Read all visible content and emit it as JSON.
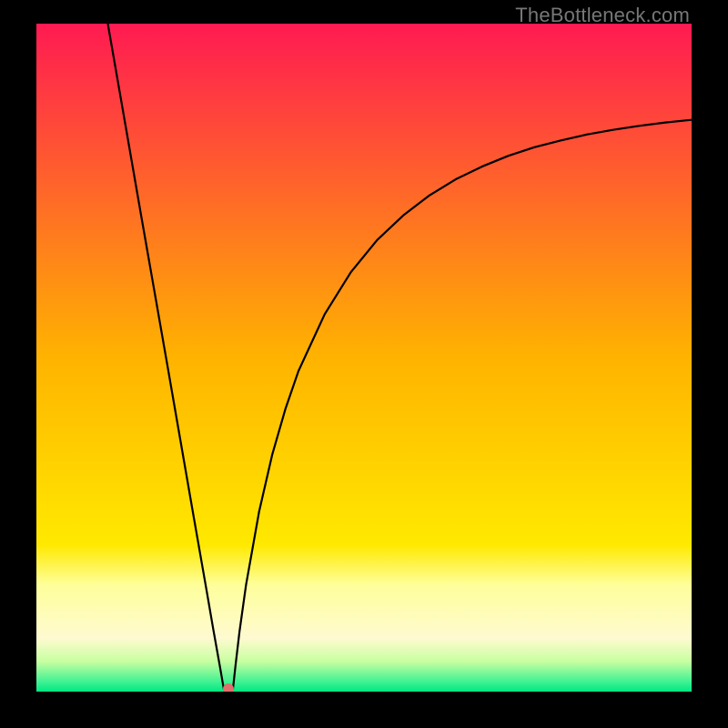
{
  "watermark": "TheBottleneck.com",
  "chart_data": {
    "type": "line",
    "title": "",
    "xlabel": "",
    "ylabel": "",
    "xlim": [
      0,
      100
    ],
    "ylim": [
      0,
      100
    ],
    "curves": [
      {
        "name": "left-branch",
        "x": [
          10.9,
          12,
          14,
          16,
          18,
          20,
          22,
          24,
          26,
          27,
          28,
          28.6
        ],
        "y": [
          100,
          93.8,
          82.5,
          71.2,
          60.0,
          48.8,
          37.5,
          26.2,
          15.0,
          9.3,
          3.8,
          0.4
        ]
      },
      {
        "name": "right-branch",
        "x": [
          30.0,
          30.4,
          31,
          32,
          34,
          36,
          38,
          40,
          44,
          48,
          52,
          56,
          60,
          64,
          68,
          72,
          76,
          80,
          84,
          88,
          92,
          96,
          100
        ],
        "y": [
          0.4,
          4,
          9,
          16,
          27,
          35.5,
          42.3,
          48,
          56.5,
          62.8,
          67.6,
          71.3,
          74.3,
          76.7,
          78.6,
          80.2,
          81.5,
          82.5,
          83.4,
          84.1,
          84.7,
          85.2,
          85.6
        ]
      }
    ],
    "marker": {
      "x": 29.3,
      "y": 0.4,
      "color": "#e26f6b"
    },
    "background_gradient": {
      "type": "vertical",
      "stops": [
        {
          "offset": 0.0,
          "color": "#ff1a52"
        },
        {
          "offset": 0.5,
          "color": "#ffb300"
        },
        {
          "offset": 0.78,
          "color": "#ffe900"
        },
        {
          "offset": 0.84,
          "color": "#feff9a"
        },
        {
          "offset": 0.92,
          "color": "#fffad0"
        },
        {
          "offset": 0.955,
          "color": "#c7ffa0"
        },
        {
          "offset": 0.985,
          "color": "#41f293"
        },
        {
          "offset": 1.0,
          "color": "#00e884"
        }
      ]
    },
    "curve_color": "#000000",
    "curve_width": 2.2,
    "grid": false
  }
}
